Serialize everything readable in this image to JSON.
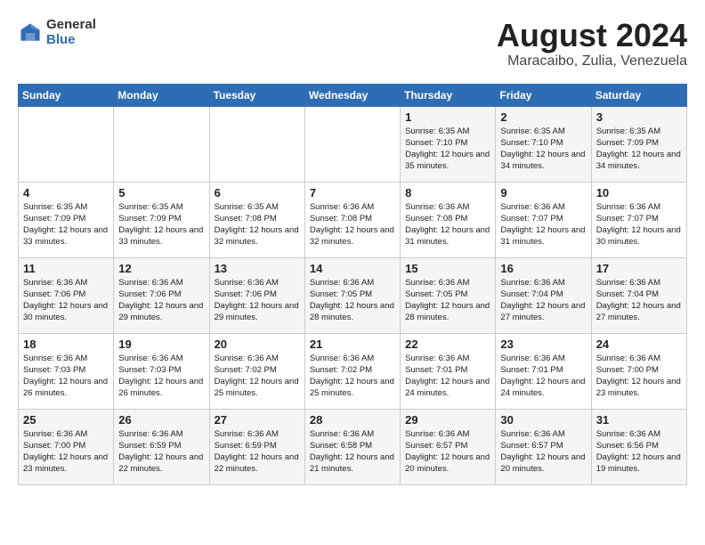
{
  "logo": {
    "general": "General",
    "blue": "Blue"
  },
  "title": "August 2024",
  "subtitle": "Maracaibo, Zulia, Venezuela",
  "days_of_week": [
    "Sunday",
    "Monday",
    "Tuesday",
    "Wednesday",
    "Thursday",
    "Friday",
    "Saturday"
  ],
  "weeks": [
    [
      {
        "day": "",
        "info": ""
      },
      {
        "day": "",
        "info": ""
      },
      {
        "day": "",
        "info": ""
      },
      {
        "day": "",
        "info": ""
      },
      {
        "day": "1",
        "info": "Sunrise: 6:35 AM\nSunset: 7:10 PM\nDaylight: 12 hours\nand 35 minutes."
      },
      {
        "day": "2",
        "info": "Sunrise: 6:35 AM\nSunset: 7:10 PM\nDaylight: 12 hours\nand 34 minutes."
      },
      {
        "day": "3",
        "info": "Sunrise: 6:35 AM\nSunset: 7:09 PM\nDaylight: 12 hours\nand 34 minutes."
      }
    ],
    [
      {
        "day": "4",
        "info": "Sunrise: 6:35 AM\nSunset: 7:09 PM\nDaylight: 12 hours\nand 33 minutes."
      },
      {
        "day": "5",
        "info": "Sunrise: 6:35 AM\nSunset: 7:09 PM\nDaylight: 12 hours\nand 33 minutes."
      },
      {
        "day": "6",
        "info": "Sunrise: 6:35 AM\nSunset: 7:08 PM\nDaylight: 12 hours\nand 32 minutes."
      },
      {
        "day": "7",
        "info": "Sunrise: 6:36 AM\nSunset: 7:08 PM\nDaylight: 12 hours\nand 32 minutes."
      },
      {
        "day": "8",
        "info": "Sunrise: 6:36 AM\nSunset: 7:08 PM\nDaylight: 12 hours\nand 31 minutes."
      },
      {
        "day": "9",
        "info": "Sunrise: 6:36 AM\nSunset: 7:07 PM\nDaylight: 12 hours\nand 31 minutes."
      },
      {
        "day": "10",
        "info": "Sunrise: 6:36 AM\nSunset: 7:07 PM\nDaylight: 12 hours\nand 30 minutes."
      }
    ],
    [
      {
        "day": "11",
        "info": "Sunrise: 6:36 AM\nSunset: 7:06 PM\nDaylight: 12 hours\nand 30 minutes."
      },
      {
        "day": "12",
        "info": "Sunrise: 6:36 AM\nSunset: 7:06 PM\nDaylight: 12 hours\nand 29 minutes."
      },
      {
        "day": "13",
        "info": "Sunrise: 6:36 AM\nSunset: 7:06 PM\nDaylight: 12 hours\nand 29 minutes."
      },
      {
        "day": "14",
        "info": "Sunrise: 6:36 AM\nSunset: 7:05 PM\nDaylight: 12 hours\nand 28 minutes."
      },
      {
        "day": "15",
        "info": "Sunrise: 6:36 AM\nSunset: 7:05 PM\nDaylight: 12 hours\nand 28 minutes."
      },
      {
        "day": "16",
        "info": "Sunrise: 6:36 AM\nSunset: 7:04 PM\nDaylight: 12 hours\nand 27 minutes."
      },
      {
        "day": "17",
        "info": "Sunrise: 6:36 AM\nSunset: 7:04 PM\nDaylight: 12 hours\nand 27 minutes."
      }
    ],
    [
      {
        "day": "18",
        "info": "Sunrise: 6:36 AM\nSunset: 7:03 PM\nDaylight: 12 hours\nand 26 minutes."
      },
      {
        "day": "19",
        "info": "Sunrise: 6:36 AM\nSunset: 7:03 PM\nDaylight: 12 hours\nand 26 minutes."
      },
      {
        "day": "20",
        "info": "Sunrise: 6:36 AM\nSunset: 7:02 PM\nDaylight: 12 hours\nand 25 minutes."
      },
      {
        "day": "21",
        "info": "Sunrise: 6:36 AM\nSunset: 7:02 PM\nDaylight: 12 hours\nand 25 minutes."
      },
      {
        "day": "22",
        "info": "Sunrise: 6:36 AM\nSunset: 7:01 PM\nDaylight: 12 hours\nand 24 minutes."
      },
      {
        "day": "23",
        "info": "Sunrise: 6:36 AM\nSunset: 7:01 PM\nDaylight: 12 hours\nand 24 minutes."
      },
      {
        "day": "24",
        "info": "Sunrise: 6:36 AM\nSunset: 7:00 PM\nDaylight: 12 hours\nand 23 minutes."
      }
    ],
    [
      {
        "day": "25",
        "info": "Sunrise: 6:36 AM\nSunset: 7:00 PM\nDaylight: 12 hours\nand 23 minutes."
      },
      {
        "day": "26",
        "info": "Sunrise: 6:36 AM\nSunset: 6:59 PM\nDaylight: 12 hours\nand 22 minutes."
      },
      {
        "day": "27",
        "info": "Sunrise: 6:36 AM\nSunset: 6:59 PM\nDaylight: 12 hours\nand 22 minutes."
      },
      {
        "day": "28",
        "info": "Sunrise: 6:36 AM\nSunset: 6:58 PM\nDaylight: 12 hours\nand 21 minutes."
      },
      {
        "day": "29",
        "info": "Sunrise: 6:36 AM\nSunset: 6:57 PM\nDaylight: 12 hours\nand 20 minutes."
      },
      {
        "day": "30",
        "info": "Sunrise: 6:36 AM\nSunset: 6:57 PM\nDaylight: 12 hours\nand 20 minutes."
      },
      {
        "day": "31",
        "info": "Sunrise: 6:36 AM\nSunset: 6:56 PM\nDaylight: 12 hours\nand 19 minutes."
      }
    ]
  ]
}
